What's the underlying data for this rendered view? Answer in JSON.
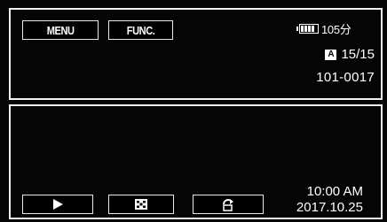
{
  "top_bar": {
    "menu_label": "MENU",
    "func_label": "FUNC."
  },
  "status": {
    "battery_icon": "battery-full-icon",
    "battery_remaining": "105分",
    "card_badge": "A",
    "file_counter": "15/15",
    "folder_file_number": "101-0017"
  },
  "bottom_bar": {
    "buttons": [
      {
        "name": "play",
        "icon": "play-icon"
      },
      {
        "name": "index",
        "icon": "index-grid-icon"
      },
      {
        "name": "return",
        "icon": "return-arrow-icon"
      }
    ],
    "time": "10:00 AM",
    "date": "2017.10.25"
  }
}
